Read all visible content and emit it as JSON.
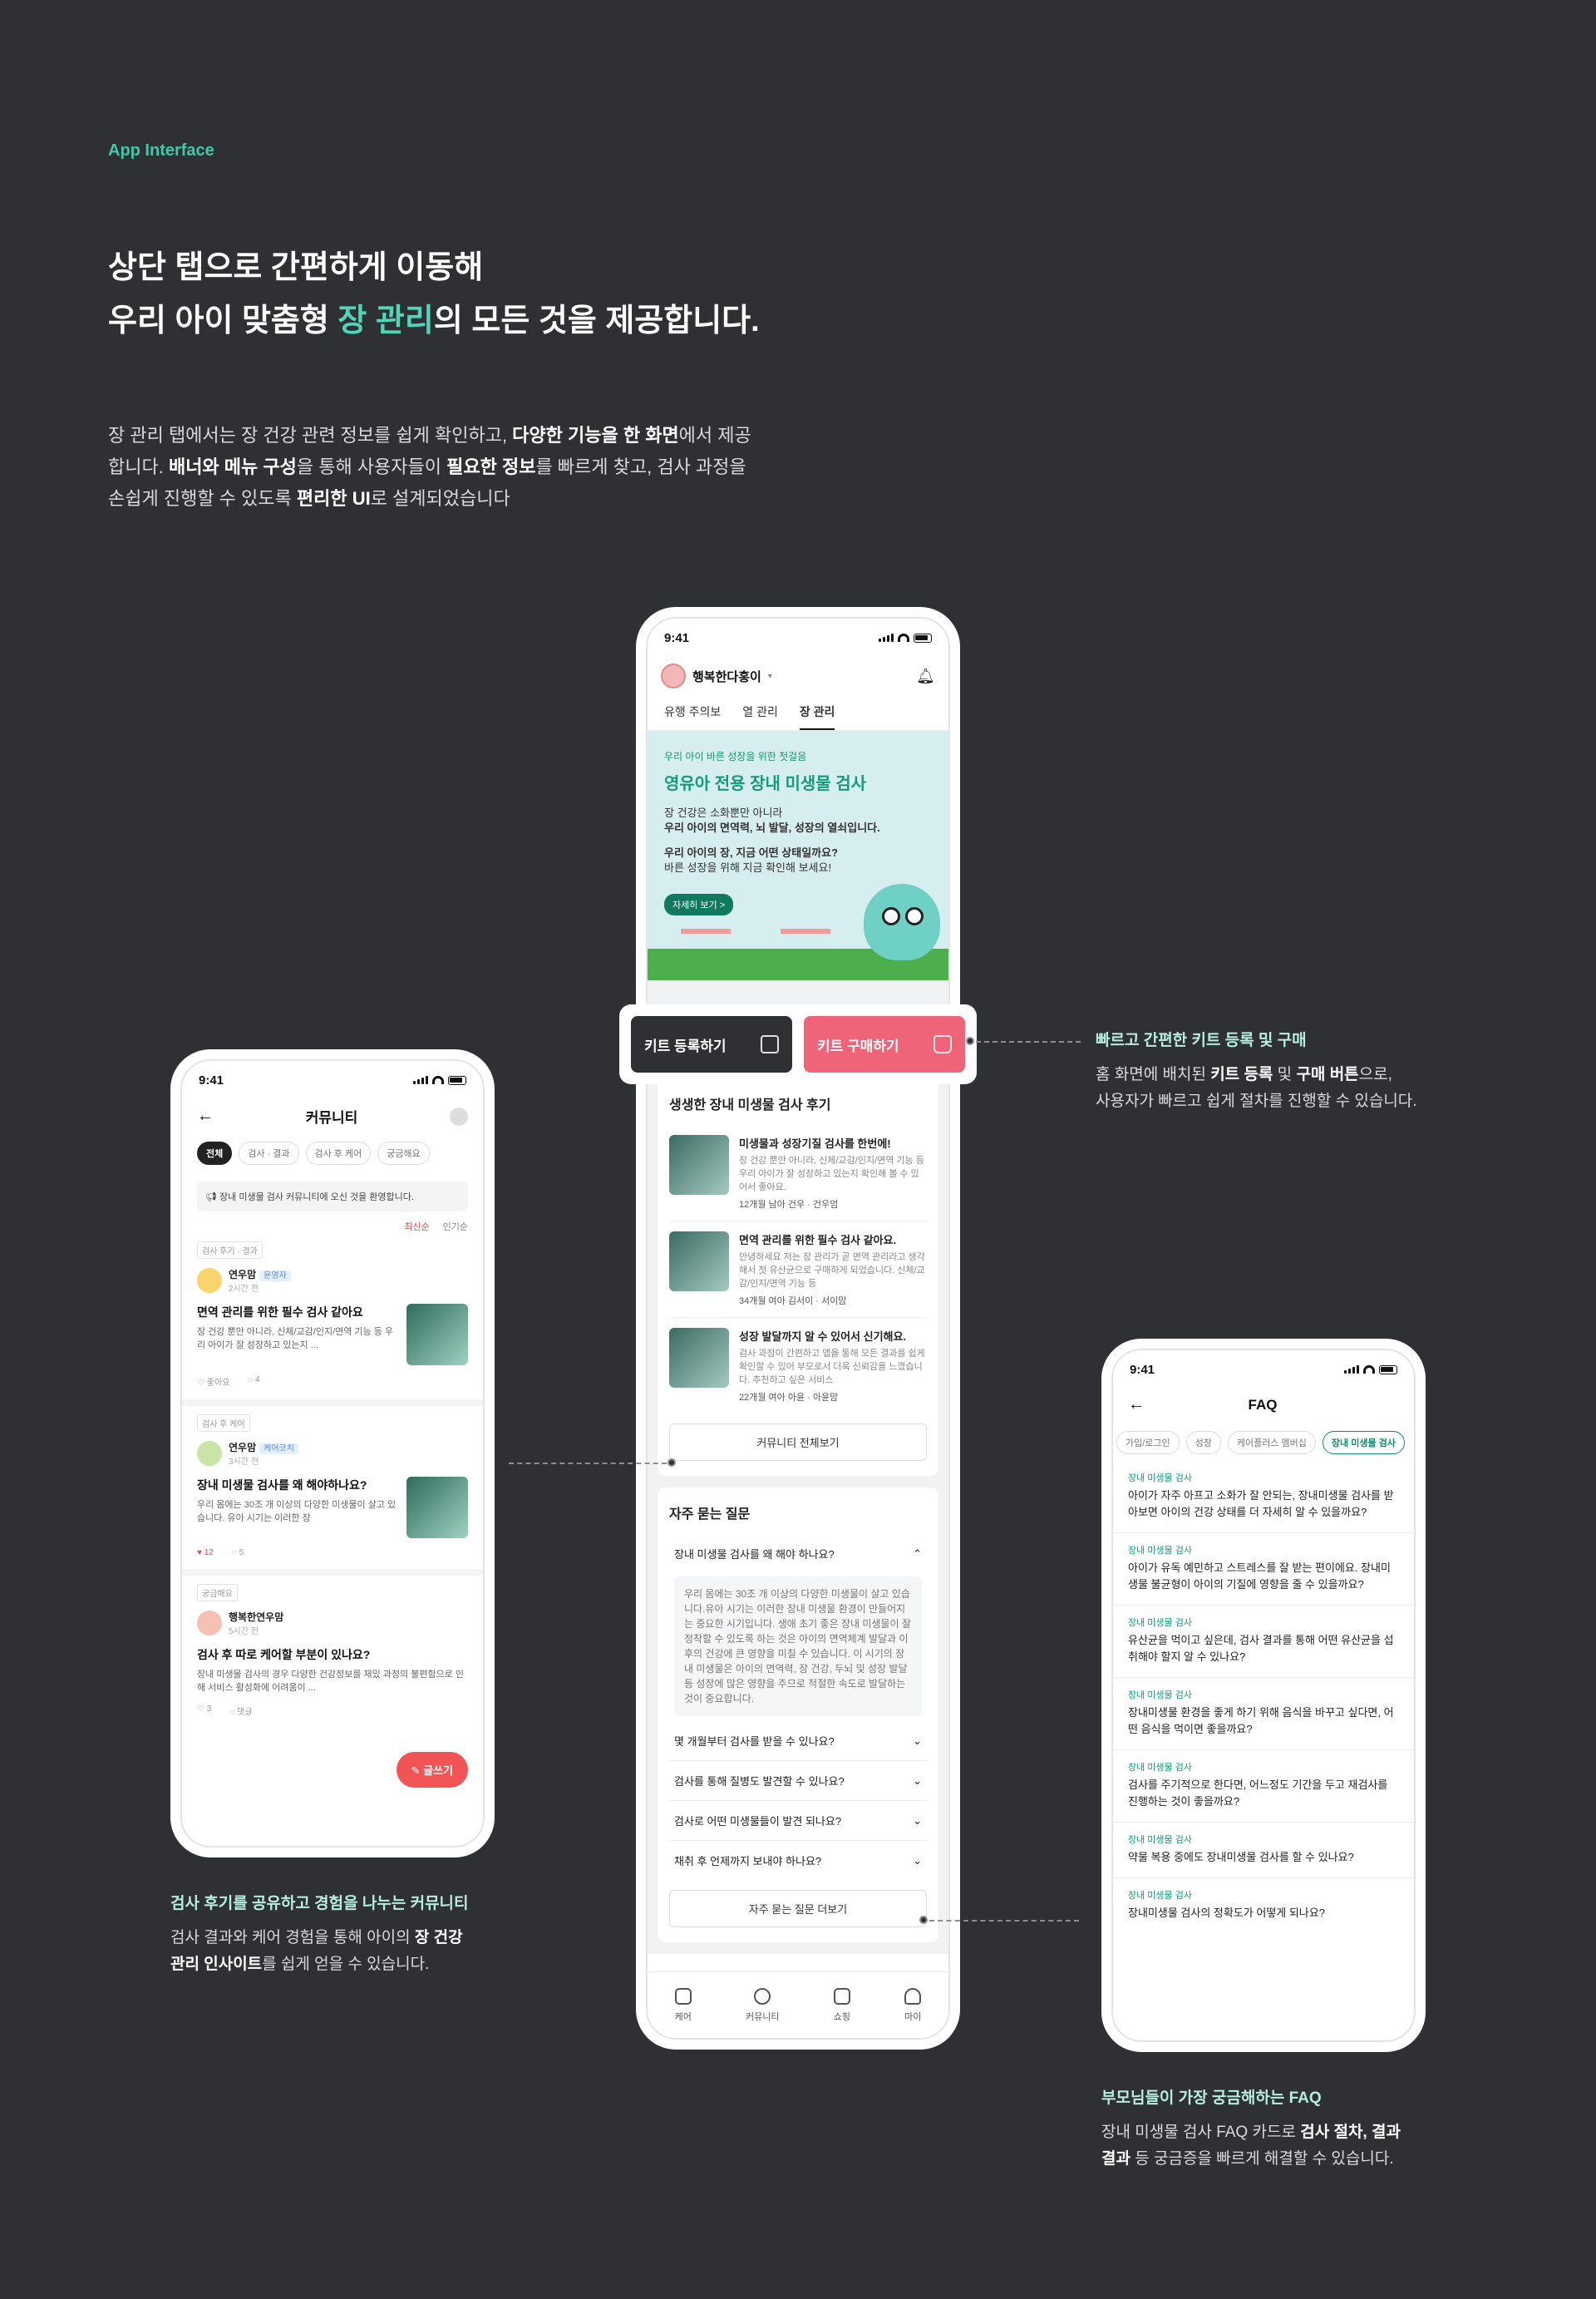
{
  "section_tag": "App Interface",
  "headline": {
    "line1": "상단 탭으로 간편하게 이동해",
    "line2_prefix": "우리 아이 맞춤형 ",
    "line2_highlight": "장 관리",
    "line2_suffix": "의  모든 것을 제공합니다."
  },
  "description": {
    "p1": "장 관리 탭에서는 장 건강 관련 정보를 쉽게 확인하고, ",
    "b1": "다양한 기능을 한 화면",
    "p2": "에서 제공합니다. ",
    "b2": "배너와 메뉴 구성",
    "p3": "을 통해 사용자들이 ",
    "b3": "필요한 정보",
    "p4": "를 빠르게 찾고, 검사 과정을 손쉽게 진행할 수 있도록 ",
    "b4": "편리한 UI",
    "p5": "로 설계되었습니다"
  },
  "status_time": "9:41",
  "home": {
    "user": "행복한다홍이",
    "tabs": [
      "유행 주의보",
      "열 관리",
      "장 관리"
    ],
    "banner": {
      "small": "우리 아이 바른 성장을 위한 첫걸음",
      "title": "영유아 전용 장내 미생물 검사",
      "l1": "장 건강은 소화뿐만 아니라",
      "l2": "우리 아이의 면역력, 뇌 발달, 성장의 열쇠입니다.",
      "l3": "우리 아이의 장, 지금 어떤 상태일까요?",
      "l4": "바른 성장을 위해 지금 확인해 보세요!",
      "button": "자세히 보기 >"
    },
    "kit_register": "키트 등록하기",
    "kit_buy": "키트 구매하기",
    "reviews_title": "생생한 장내 미생물 검사 후기",
    "reviews": [
      {
        "title": "미생물과 성장기질 검사를 한번에!",
        "body": "장 건강 뿐만 아니라, 신체/교감/인지/면역 기능 등 우리 아이가 잘 성장하고 있는지 확인해 볼 수 있어서 좋아요.",
        "meta": "12개월 남아 건우 · 건우엄"
      },
      {
        "title": "면역 관리를 위한 필수 검사 같아요.",
        "body": "안녕하세요 저는 장 관리가 곧 면역 관리라고 생각해서 첫 유산균으로 구매하게 되었습니다. 신체/교감/인지/면역 기능 등",
        "meta": "34개월 여아 김서이 · 서이맘"
      },
      {
        "title": "성장 발달까지 알 수 있어서 신기해요.",
        "body": "검사 과정이 간편하고 앱을 통해 모든 결과를 쉽게 확인할 수 있어 부모로서 더욱 신뢰감을 느꼈습니다. 추천하고 싶은 서비스",
        "meta": "22개월 여아 아윤 · 아윤맘"
      }
    ],
    "community_all": "커뮤니티 전체보기",
    "faq_title": "자주 묻는 질문",
    "faq_open_q": "장내 미생물 검사를 왜 해야 하나요?",
    "faq_open_a": "우리 몸에는 30조 개 이상의 다양한 미생물이 살고 있습니다.유아 시기는 이러한 장내 미생물 환경이 만들어지는 중요한 시기입니다. 생애 초기 좋은 장내 미생물이 잘 정착할 수 있도록 하는 것은 아이의 면역체계 발달과 이후의 건강에 큰 영향을 미칠 수 있습니다. 이 시기의 장내 미생물은 아이의 면역력, 장 건강, 두뇌 및 성장 발달 등 성장에 많은 영향을 주므로 적절한 속도로 발달하는 것이 중요합니다.",
    "faq_items": [
      "몇 개월부터 검사를 받을 수 있나요?",
      "검사를 통해 질병도 발견할 수 있나요?",
      "검사로 어떤 미생물들이 발견 되나요?",
      "채취 후 언제까지 보내야 하나요?"
    ],
    "faq_more": "자주 묻는 질문 더보기",
    "tabbar": [
      "케어",
      "커뮤니티",
      "쇼핑",
      "마이"
    ]
  },
  "community": {
    "title": "커뮤니티",
    "chips": [
      "전체",
      "검사 · 결과",
      "검사 후 케어",
      "궁금해요"
    ],
    "notice": "장내 미생물 검사 커뮤니티에 오신 것을 환영합니다.",
    "sort": [
      "최신순",
      "인기순"
    ],
    "posts": [
      {
        "label": "검사 후기 · 결과",
        "author": "연우맘",
        "role": "운영자",
        "time": "2시간 전",
        "title": "면역 관리를 위한 필수 검사 같아요",
        "body": "장 건강 뿐만 아니라, 신체/교감/인지/면역 기능 등 우리 아이가 잘 성장하고 있는지 ...",
        "likes": "좋아요",
        "comments": "4"
      },
      {
        "label": "검사 후 케어",
        "author": "연우맘",
        "role": "케어코치",
        "time": "3시간 전",
        "title": "장내 미생물 검사를 왜 해야하나요?",
        "body": "우리 몸에는 30조 개 이상의 다양한 미생물이 살고 있습니다. 유아 시기는 이러한 장",
        "likes": "12",
        "comments": "5"
      },
      {
        "label": "궁금해요",
        "author": "행복한연우맘",
        "role": "",
        "time": "5시간 전",
        "title": "검사 후 따로 케어할 부분이 있나요?",
        "body": "장내 미생물 검사의 경우 다양한 건강정보를 재밌 과정의 불편함으로 인해 서비스 활성화에 어려움이 ...",
        "likes": "3",
        "comments": "댓글"
      }
    ],
    "write": "글쓰기"
  },
  "faq_page": {
    "title": "FAQ",
    "chips": [
      "가입/로그인",
      "성장",
      "케어플러스 멤버십",
      "장내 미생물 검사"
    ],
    "items": [
      {
        "cat": "장내 미생물 검사",
        "q": "아이가 자주 아프고 소화가 잘 안되는, 장내미생물 검사를 받아보면 아이의 건강 상태를 더 자세히 알 수 있을까요?"
      },
      {
        "cat": "장내 미생물 검사",
        "q": "아이가 유독 예민하고 스트레스를 잘 받는 편이에요. 장내미생물 불균형이 아이의 기질에 영향을 줄 수 있을까요?"
      },
      {
        "cat": "장내 미생물 검사",
        "q": "유산균을 먹이고 싶은데, 검사 결과를 통해 어떤 유산균을 섭취해야 할지 알 수 있나요?"
      },
      {
        "cat": "장내 미생물 검사",
        "q": "장내미생물 환경을 좋게 하기 위해 음식을 바꾸고 싶다면, 어떤 음식을 먹이면 좋을까요?"
      },
      {
        "cat": "장내 미생물 검사",
        "q": "검사를 주기적으로 한다면, 어느정도 기간을 두고 재검사를 진행하는 것이 좋을까요?"
      },
      {
        "cat": "장내 미생물 검사",
        "q": "약물 복용 중에도 장내미생물 검사를 할 수 있나요?"
      },
      {
        "cat": "장내 미생물 검사",
        "q": "장내미생물 검사의 정확도가 어떻게 되나요?"
      }
    ]
  },
  "callouts": {
    "kit": {
      "title": "빠르고 간편한 키트 등록 및 구매",
      "t1": "홈 화면에 배치된 ",
      "b1": "키트 등록",
      "t2": " 및 ",
      "b2": "구매 버튼",
      "t3": "으로,",
      "t4": "사용자가 빠르고 쉽게 절차를 진행할 수 있습니다."
    },
    "community": {
      "title": "검사 후기를 공유하고 경험을 나누는 커뮤니티",
      "t1": "검사 결과와 케어 경험을 통해 아이의 ",
      "b1": "장 건강",
      "b2": "관리 인사이트",
      "t2": "를 쉽게 얻을 수 있습니다."
    },
    "faq": {
      "title": "부모님들이 가장 궁금해하는 FAQ",
      "t1": "장내 미생물 검사 FAQ 카드로 ",
      "b1": "검사 절차, 결과",
      "b2": "결과",
      "t2": " 등 궁금증을 빠르게 해결할 수 있습니다."
    }
  }
}
